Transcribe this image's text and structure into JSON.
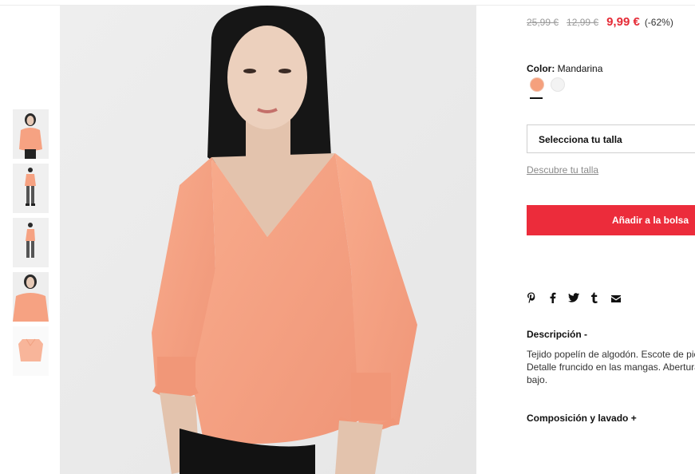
{
  "product": {
    "prices": {
      "original": "25,99 €",
      "previous": "12,99 €",
      "current": "9,99 €",
      "discount": "(-62%)"
    },
    "color": {
      "label": "Color:",
      "value": "Mandarina",
      "swatches": [
        "#f5a07d",
        "#f3f3f3"
      ]
    },
    "size": {
      "placeholder": "Selecciona tu talla",
      "guide_link": "Descubre tu talla"
    },
    "add_to_bag": "Añadir a la bolsa",
    "share": [
      "pinterest-icon",
      "facebook-icon",
      "twitter-icon",
      "tumblr-icon",
      "email-icon"
    ],
    "description": {
      "title": "Descripción",
      "toggle": "-",
      "lines": [
        "Tejido popelín de algodón. Escote de pic",
        "Detalle fruncido en las mangas. Abertura",
        "bajo."
      ]
    },
    "composition": {
      "title": "Composición y lavado",
      "toggle": "+"
    }
  },
  "gallery": {
    "thumbnail_count": 5,
    "garment_color": "#f6a282"
  }
}
